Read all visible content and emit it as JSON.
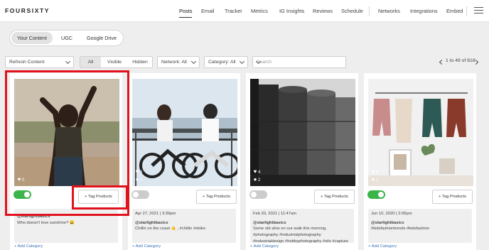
{
  "nav": {
    "logo": "FOURSIXTY",
    "items": [
      "Posts",
      "Email",
      "Tracker",
      "Metrics",
      "IG Insights",
      "Reviews",
      "Schedule",
      "Networks",
      "Integrations",
      "Embed"
    ],
    "active": "Posts"
  },
  "content_tabs": [
    "Your Content",
    "UGC",
    "Google Drive"
  ],
  "active_content_tab": "Your Content",
  "filters": {
    "refresh": "Refresh Content",
    "visibility": [
      "All",
      "Visible",
      "Hidden"
    ],
    "active_visibility": "All",
    "network": "Network: All",
    "category": "Category: All",
    "search_placeholder": "Search"
  },
  "pager": {
    "range": "1 to 49 of 618"
  },
  "posts": [
    {
      "likes": "0",
      "comments": "",
      "enabled": true,
      "tag_button": "+ Tag Products",
      "date": "",
      "user": "@starlightbasics",
      "caption": "Who doesn't love sunshine? 😄",
      "add_category": "+ Add Category",
      "image": "dancing-woman"
    },
    {
      "likes": "8",
      "comments": "1",
      "enabled": false,
      "tag_button": "+ Tag Products",
      "date": "Apr 27, 2021 | 3:39pm",
      "user": "@starlightbasics",
      "caption": "Chillin on the coast 🤙 , #chillin #ebike",
      "add_category": "+ Add Category",
      "image": "ebikes-coast"
    },
    {
      "likes": "4",
      "comments": "2",
      "enabled": false,
      "tag_button": "+ Tag Products",
      "date": "Feb 20, 2021 | 11:47am",
      "user": "@starlightbasics",
      "caption": "Some old silos on our walk this morning. #photography #industrialphotography #industrialdesign #hobbyphotography #silo #capture",
      "add_category": "+ Add Category",
      "image": "silos"
    },
    {
      "likes": "8",
      "comments": "1",
      "enabled": true,
      "tag_button": "+ Tag Products",
      "date": "Jun 10, 2020 | 2:06pm",
      "user": "@starlightbasics",
      "caption": "#kidsfashiontrends #kidsfashion",
      "add_category": "+ Add Category",
      "image": "kids-clothes"
    }
  ],
  "colors": {
    "toggle_on": "#3bb44a",
    "highlight": "#e2121d",
    "link": "#3a73b8"
  }
}
